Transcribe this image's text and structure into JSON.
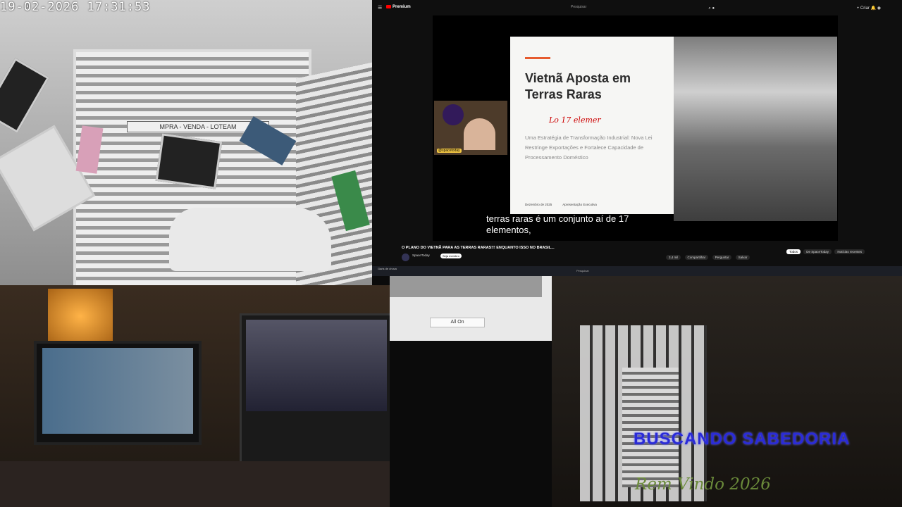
{
  "cctv": {
    "timestamp": "19-02-2026 17:31:53",
    "sign_text": "MPRA - VENDA - LOTEAM"
  },
  "youtube": {
    "logo": "Premium",
    "search_placeholder": "Pesquisar",
    "create_label": "+ Criar",
    "slide": {
      "title": "Vietnã Aposta em Terras Raras",
      "handwriting": "Lo 17 elemer",
      "subtitle": "Uma Estratégia de Transformação Industrial: Nova Lei Restringe Exportações e Fortalece Capacidade de Processamento Doméstico",
      "footer_date": "Dezembro de 2025",
      "footer_label": "Apresentação Executiva"
    },
    "webcam_badge": "@spacetoday",
    "caption": "terras raras é um conjunto aí de 17 elementos,",
    "video_title": "O PLANO DO VIETNÃ PARA AS TERRAS RARAS!!! ENQUANTO ISSO NO BRASIL...",
    "channel": "SpaceToday",
    "subscribe": "Seja membro",
    "actions": [
      "3,4 mil",
      "Compartilhar",
      "Perguntar",
      "Salvar"
    ],
    "chips": [
      "Todos",
      "De SpaceToday",
      "Notícias recentes"
    ],
    "taskbar_weather": "Garis de chuva",
    "taskbar_search": "Pesquisar"
  },
  "middle": {
    "button": "All On"
  },
  "overlay": {
    "line1": "BUSCANDO SABEDORIA",
    "line2": "Rem Vindo 2026"
  }
}
